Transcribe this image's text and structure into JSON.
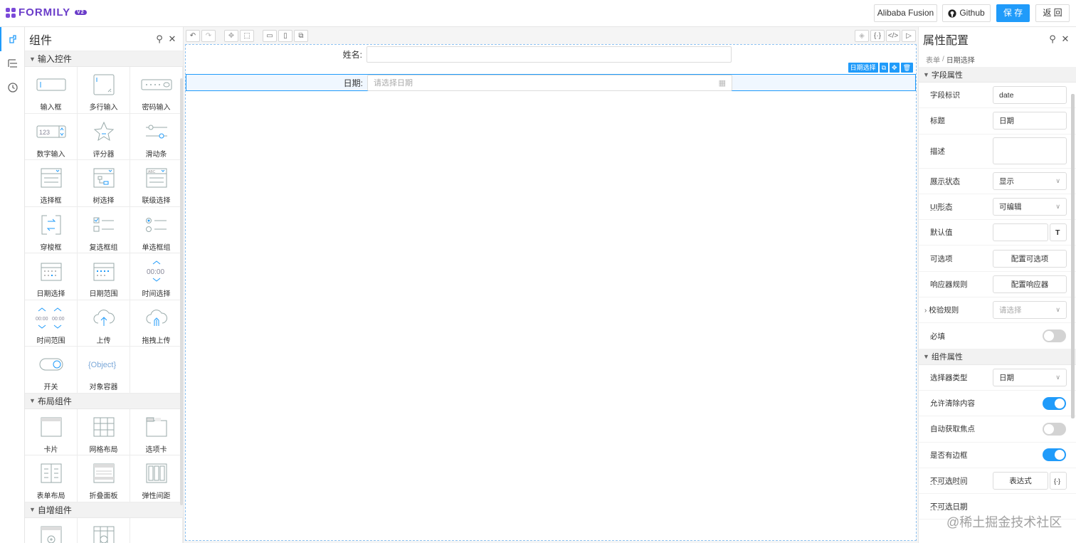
{
  "topbar": {
    "logo_text": "FORMILY",
    "logo_badge": "V2",
    "btn_alibaba": "Alibaba Fusion",
    "btn_github": "Github",
    "btn_save": "保 存",
    "btn_back": "返 回",
    "accent": "#209bfa",
    "brand": "#6a3cc9"
  },
  "components_panel": {
    "title": "组件",
    "groups": [
      {
        "title": "输入控件",
        "items": [
          {
            "label": "输入框",
            "icon": "input-icon"
          },
          {
            "label": "多行输入",
            "icon": "textarea-icon"
          },
          {
            "label": "密码输入",
            "icon": "password-icon"
          },
          {
            "label": "数字输入",
            "icon": "number-input-icon"
          },
          {
            "label": "评分器",
            "icon": "rate-icon"
          },
          {
            "label": "滑动条",
            "icon": "slider-icon"
          },
          {
            "label": "选择框",
            "icon": "select-icon"
          },
          {
            "label": "树选择",
            "icon": "tree-select-icon"
          },
          {
            "label": "联级选择",
            "icon": "cascader-icon"
          },
          {
            "label": "穿梭框",
            "icon": "transfer-icon"
          },
          {
            "label": "复选框组",
            "icon": "checkbox-group-icon"
          },
          {
            "label": "单选框组",
            "icon": "radio-group-icon"
          },
          {
            "label": "日期选择",
            "icon": "date-picker-icon"
          },
          {
            "label": "日期范围",
            "icon": "date-range-icon"
          },
          {
            "label": "时间选择",
            "icon": "time-picker-icon"
          },
          {
            "label": "时间范围",
            "icon": "time-range-icon"
          },
          {
            "label": "上传",
            "icon": "upload-icon"
          },
          {
            "label": "拖拽上传",
            "icon": "drag-upload-icon"
          },
          {
            "label": "开关",
            "icon": "switch-icon"
          },
          {
            "label": "对象容器",
            "icon": "object-icon"
          }
        ]
      },
      {
        "title": "布局组件",
        "items": [
          {
            "label": "卡片",
            "icon": "card-icon"
          },
          {
            "label": "网格布局",
            "icon": "grid-icon"
          },
          {
            "label": "选项卡",
            "icon": "tabs-icon"
          },
          {
            "label": "表单布局",
            "icon": "form-layout-icon"
          },
          {
            "label": "折叠面板",
            "icon": "collapse-icon"
          },
          {
            "label": "弹性间距",
            "icon": "space-icon"
          }
        ]
      },
      {
        "title": "自增组件",
        "items": []
      }
    ],
    "number_glyph": "123",
    "time_glyph": "00:00",
    "object_glyph": "{Object}"
  },
  "canvas": {
    "fields": [
      {
        "label": "姓名:",
        "value": ""
      },
      {
        "label": "日期:",
        "placeholder": "请选择日期"
      }
    ],
    "selection_tag": "日期选择"
  },
  "props_panel": {
    "title": "属性配置",
    "breadcrumb_root": "表单",
    "breadcrumb_sep": "/",
    "breadcrumb_current": "日期选择",
    "field_group": "字段属性",
    "component_group": "组件属性",
    "rows": {
      "field_id": {
        "label": "字段标识",
        "value": "date"
      },
      "title": {
        "label": "标题",
        "value": "日期"
      },
      "desc": {
        "label": "描述",
        "value": ""
      },
      "display": {
        "label": "展示状态",
        "value": "显示"
      },
      "pattern": {
        "label": "UI形态",
        "value": "可编辑"
      },
      "default": {
        "label": "默认值",
        "value": ""
      },
      "options": {
        "label": "可选项",
        "button": "配置可选项"
      },
      "reactions": {
        "label": "响应器规则",
        "button": "配置响应器"
      },
      "validator": {
        "label": "校验规则",
        "placeholder": "请选择"
      },
      "required": {
        "label": "必填",
        "on": false
      },
      "picker": {
        "label": "选择器类型",
        "value": "日期"
      },
      "allow_clear": {
        "label": "允许清除内容",
        "on": true
      },
      "autofocus": {
        "label": "自动获取焦点",
        "on": false
      },
      "bordered": {
        "label": "是否有边框",
        "on": true
      },
      "disabled_time": {
        "label": "不可选时间",
        "button": "表达式"
      },
      "disabled_date": {
        "label": "不可选日期"
      }
    }
  },
  "watermark": "@稀土掘金技术社区"
}
